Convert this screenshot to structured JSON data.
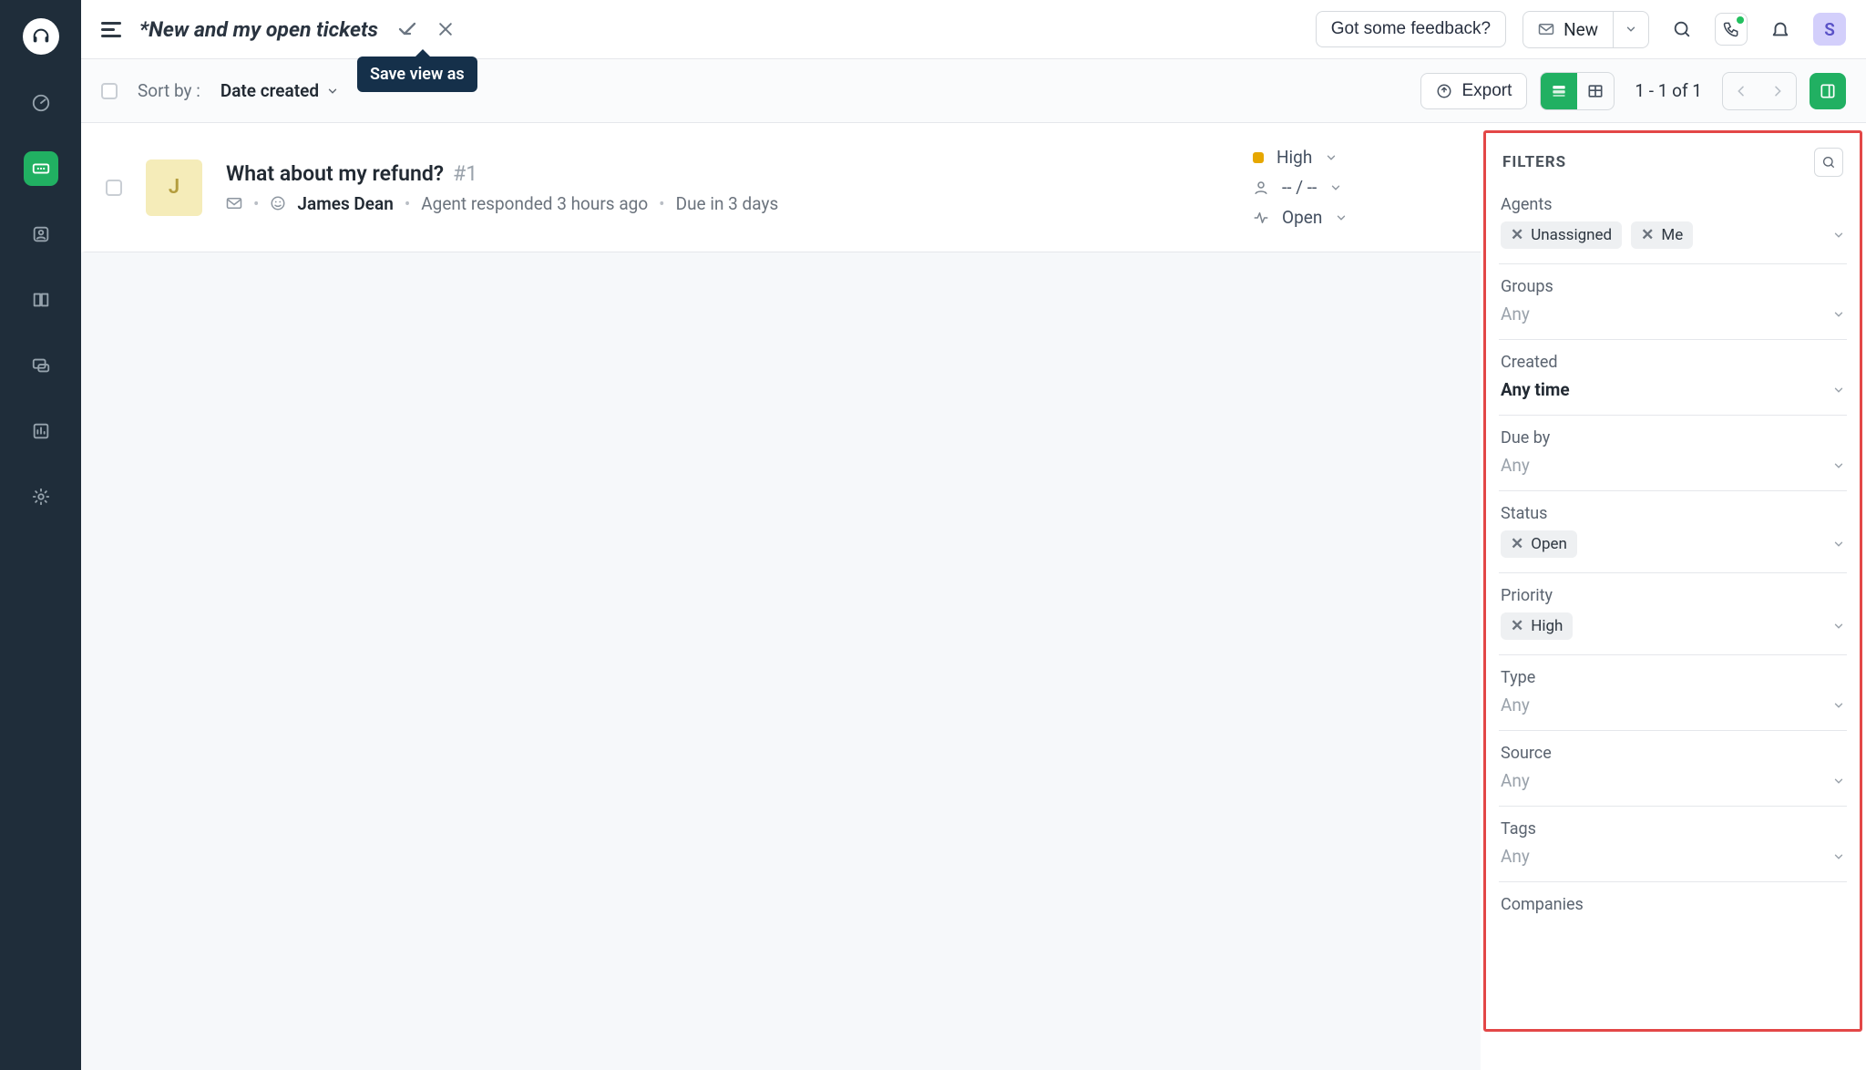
{
  "header": {
    "view_title": "*New and my open tickets",
    "save_tooltip": "Save view as",
    "feedback_label": "Got some feedback?",
    "new_label": "New",
    "user_initial": "S"
  },
  "toolbar": {
    "sort_label": "Sort by :",
    "sort_value": "Date created",
    "export_label": "Export",
    "pagination": "1 - 1 of 1"
  },
  "tickets": [
    {
      "avatar_initial": "J",
      "subject": "What about my refund?",
      "ticket_id": "#1",
      "requester": "James Dean",
      "status_text": "Agent responded 3 hours ago",
      "due_text": "Due in 3 days",
      "priority": "High",
      "assigned": "-- / --",
      "status": "Open"
    }
  ],
  "filters": {
    "title": "FILTERS",
    "fields": {
      "agents": {
        "label": "Agents",
        "chips": [
          "Unassigned",
          "Me"
        ]
      },
      "groups": {
        "label": "Groups",
        "placeholder": "Any"
      },
      "created": {
        "label": "Created",
        "value": "Any time"
      },
      "dueby": {
        "label": "Due by",
        "placeholder": "Any"
      },
      "status": {
        "label": "Status",
        "chips": [
          "Open"
        ]
      },
      "priority": {
        "label": "Priority",
        "chips": [
          "High"
        ]
      },
      "type": {
        "label": "Type",
        "placeholder": "Any"
      },
      "source": {
        "label": "Source",
        "placeholder": "Any"
      },
      "tags": {
        "label": "Tags",
        "placeholder": "Any"
      },
      "companies": {
        "label": "Companies"
      }
    }
  }
}
